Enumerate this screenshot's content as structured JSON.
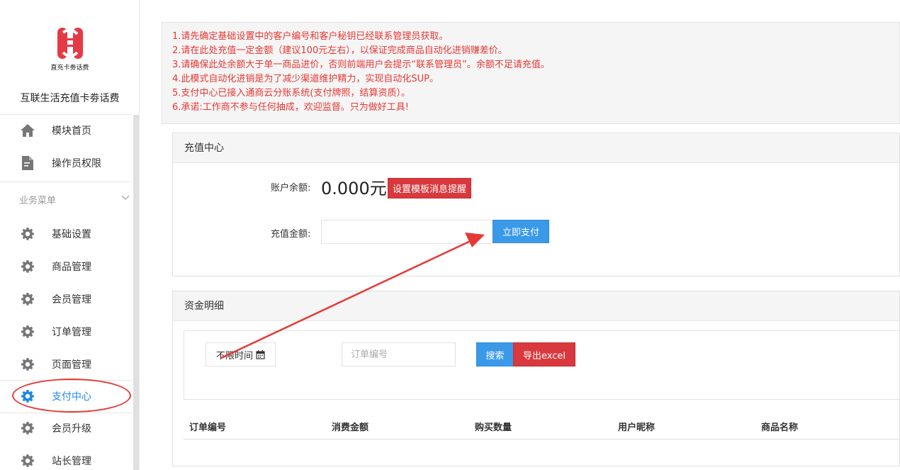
{
  "sidebar": {
    "logo_caption": "直充卡劵话费",
    "app_name": "互联生活充值卡劵话费",
    "top_items": [
      {
        "label": "模块首页",
        "icon": "home-icon"
      },
      {
        "label": "操作员权限",
        "icon": "document-edit-icon"
      }
    ],
    "section_title": "业务菜单",
    "items": [
      {
        "label": "基础设置",
        "icon": "gear-icon"
      },
      {
        "label": "商品管理",
        "icon": "gear-icon"
      },
      {
        "label": "会员管理",
        "icon": "gear-icon"
      },
      {
        "label": "订单管理",
        "icon": "gear-icon"
      },
      {
        "label": "页面管理",
        "icon": "gear-icon"
      },
      {
        "label": "支付中心",
        "icon": "gear-icon",
        "active": true
      },
      {
        "label": "会员升级",
        "icon": "gear-icon"
      },
      {
        "label": "站长管理",
        "icon": "gear-icon"
      }
    ],
    "colors": {
      "active": "#1e88e5",
      "icon": "#777777",
      "logo": "#e53945"
    }
  },
  "notice": {
    "lines": [
      "1.请先确定基础设置中的客户编号和客户秘钥已经联系管理员获取。",
      "2.请在此处充值一定金额（建议100元左右），以保证完成商品自动化进销赚差价。",
      "3.请确保此处余额大于单一商品进价，否则前端用户会提示“联系管理员”。余额不足请充值。",
      "4.此模式自动化进销是为了减少渠道维护精力，实现自动化SUP。",
      "5.支付中心已接入通商云分账系统(支付牌照，结算资质）。",
      "6.承诺:工作商不参与任何抽成，欢迎监督。只为做好工具!"
    ],
    "color": "#e53935"
  },
  "recharge": {
    "title": "充值中心",
    "balance_label": "账户余额:",
    "balance_value": "0.000元",
    "template_button": "设置模板消息提醒",
    "amount_label": "充值金额:",
    "amount_value": "",
    "pay_button": "立即支付"
  },
  "funds": {
    "title": "资金明细",
    "date_filter": "不限时间",
    "order_placeholder": "订单编号",
    "search_button": "搜索",
    "export_button": "导出excel",
    "columns": [
      "订单编号",
      "消费金额",
      "购买数量",
      "用户昵称",
      "商品名称"
    ]
  },
  "annotation_color": "#e53935"
}
